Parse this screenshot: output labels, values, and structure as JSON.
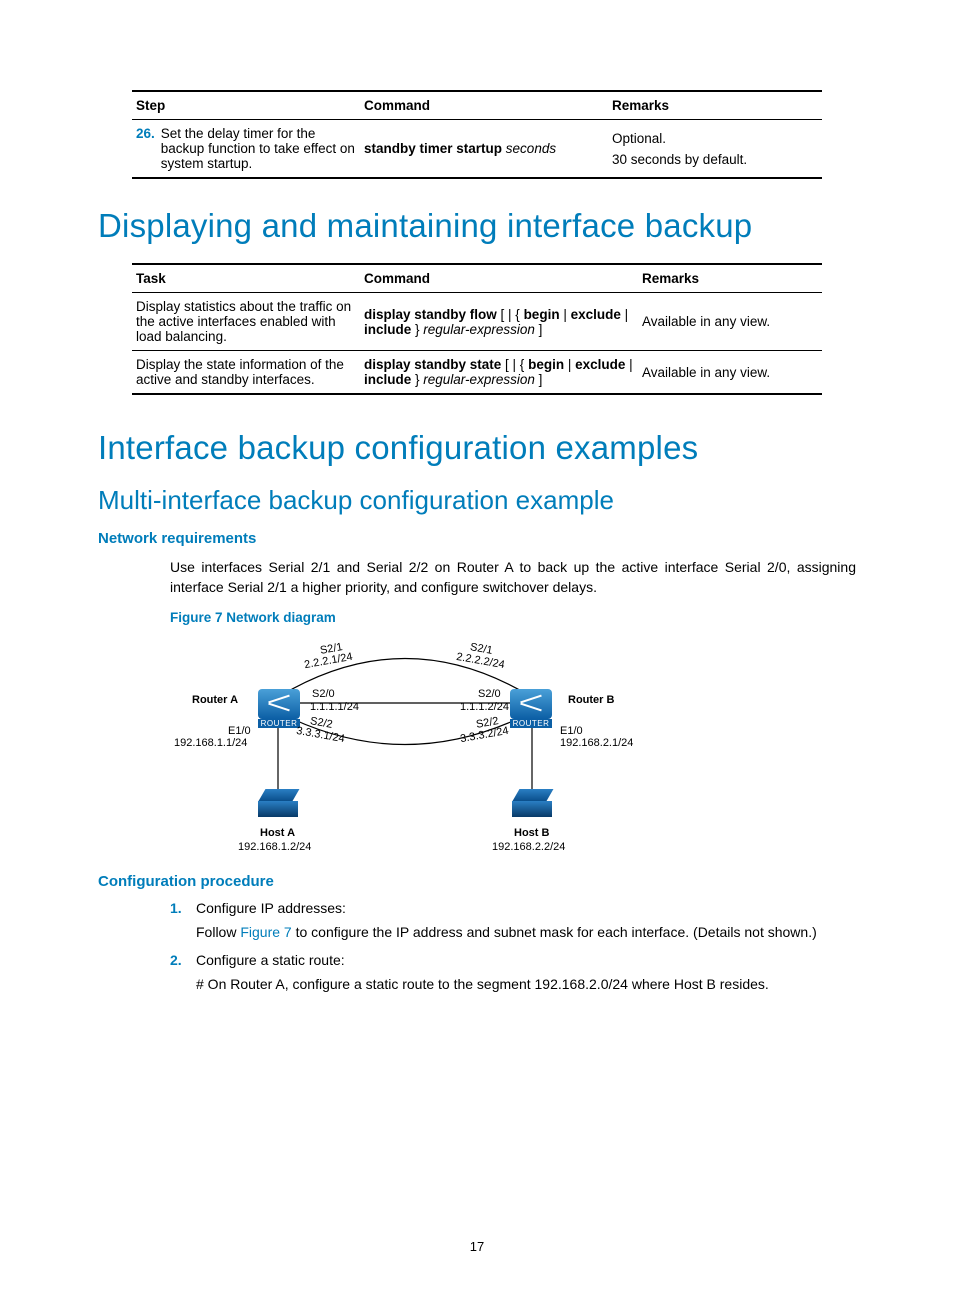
{
  "table1": {
    "headers": {
      "step": "Step",
      "command": "Command",
      "remarks": "Remarks"
    },
    "row": {
      "num": "26.",
      "step": "Set the delay timer for the backup function to take effect on system startup.",
      "cmd_bold": "standby timer startup",
      "cmd_ital": "seconds",
      "remarks_l1": "Optional.",
      "remarks_l2": "30 seconds by default."
    }
  },
  "h1a": "Displaying and maintaining interface backup",
  "table2": {
    "headers": {
      "task": "Task",
      "command": "Command",
      "remarks": "Remarks"
    },
    "rows": [
      {
        "task": "Display statistics about the traffic on the active interfaces enabled with load balancing.",
        "cmd_parts": {
          "p1": "display standby flow",
          "p2": " [ | { ",
          "p3": "begin",
          "p4": " | ",
          "p5": "exclude",
          "p6": " | ",
          "p7": "include",
          "p8": " } ",
          "p9": "regular-expression",
          "p10": " ]"
        },
        "remarks": "Available in any view."
      },
      {
        "task": "Display the state information of the active and standby interfaces.",
        "cmd_parts": {
          "p1": "display standby state",
          "p2": " [ | { ",
          "p3": "begin",
          "p4": " | ",
          "p5": "exclude",
          "p6": " | ",
          "p7": "include",
          "p8": " } ",
          "p9": "regular-expression",
          "p10": " ]"
        },
        "remarks": "Available in any view."
      }
    ]
  },
  "h1b": "Interface backup configuration examples",
  "h2": "Multi-interface backup configuration example",
  "h3a": "Network requirements",
  "body1": "Use interfaces Serial 2/1 and Serial 2/2 on Router A to back up the active interface Serial 2/0, assigning interface Serial 2/1 a higher priority, and configure switchover delays.",
  "figcap": "Figure 7 Network diagram",
  "diagram": {
    "routerA": "Router A",
    "routerB": "Router B",
    "hostA": "Host A",
    "hostB": "Host B",
    "routerLabel": "ROUTER",
    "a_s21": "S2/1",
    "a_s21_ip": "2.2.2.1/24",
    "a_s20": "S2/0",
    "a_s20_ip": "1.1.1.1/24",
    "a_s22": "S2/2",
    "a_s22_ip": "3.3.3.1/24",
    "a_e10": "E1/0",
    "a_e10_ip": "192.168.1.1/24",
    "b_s21": "S2/1",
    "b_s21_ip": "2.2.2.2/24",
    "b_s20": "S2/0",
    "b_s20_ip": "1.1.1.2/24",
    "b_s22": "S2/2",
    "b_s22_ip": "3.3.3.2/24",
    "b_e10": "E1/0",
    "b_e10_ip": "192.168.2.1/24",
    "hostA_ip": "192.168.1.2/24",
    "hostB_ip": "192.168.2.2/24"
  },
  "h3b": "Configuration procedure",
  "steps": [
    {
      "num": "1.",
      "title": "Configure IP addresses:",
      "body_pre": "Follow ",
      "body_link": "Figure 7",
      "body_post": " to configure the IP address and subnet mask for each interface. (Details not shown.)"
    },
    {
      "num": "2.",
      "title": "Configure a static route:",
      "body": "# On Router A, configure a static route to the segment 192.168.2.0/24 where Host B resides."
    }
  ],
  "pagenum": "17"
}
